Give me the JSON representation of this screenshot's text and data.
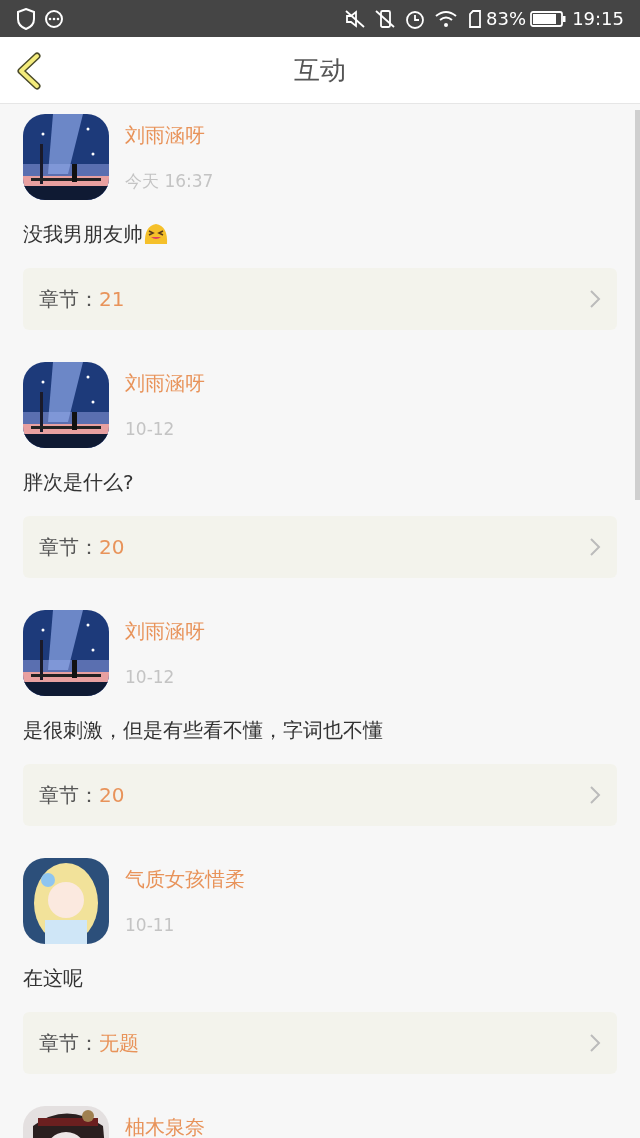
{
  "status_bar": {
    "battery": "83%",
    "time": "19:15"
  },
  "header": {
    "title": "互动"
  },
  "comments": [
    {
      "name": "刘雨涵呀",
      "time": "今天 16:37",
      "text": "没我男朋友帅",
      "emoji": true,
      "chapter_label": "章节：",
      "chapter": "21"
    },
    {
      "name": "刘雨涵呀",
      "time": "10-12",
      "text": "胖次是什么?",
      "emoji": false,
      "chapter_label": "章节：",
      "chapter": "20"
    },
    {
      "name": "刘雨涵呀",
      "time": "10-12",
      "text": "是很刺激，但是有些看不懂，字词也不懂",
      "emoji": false,
      "chapter_label": "章节：",
      "chapter": "20"
    },
    {
      "name": "气质女孩惜柔",
      "time": "10-11",
      "text": "在这呢",
      "emoji": false,
      "chapter_label": "章节：",
      "chapter": "无题"
    },
    {
      "name": "柚木泉奈"
    }
  ]
}
